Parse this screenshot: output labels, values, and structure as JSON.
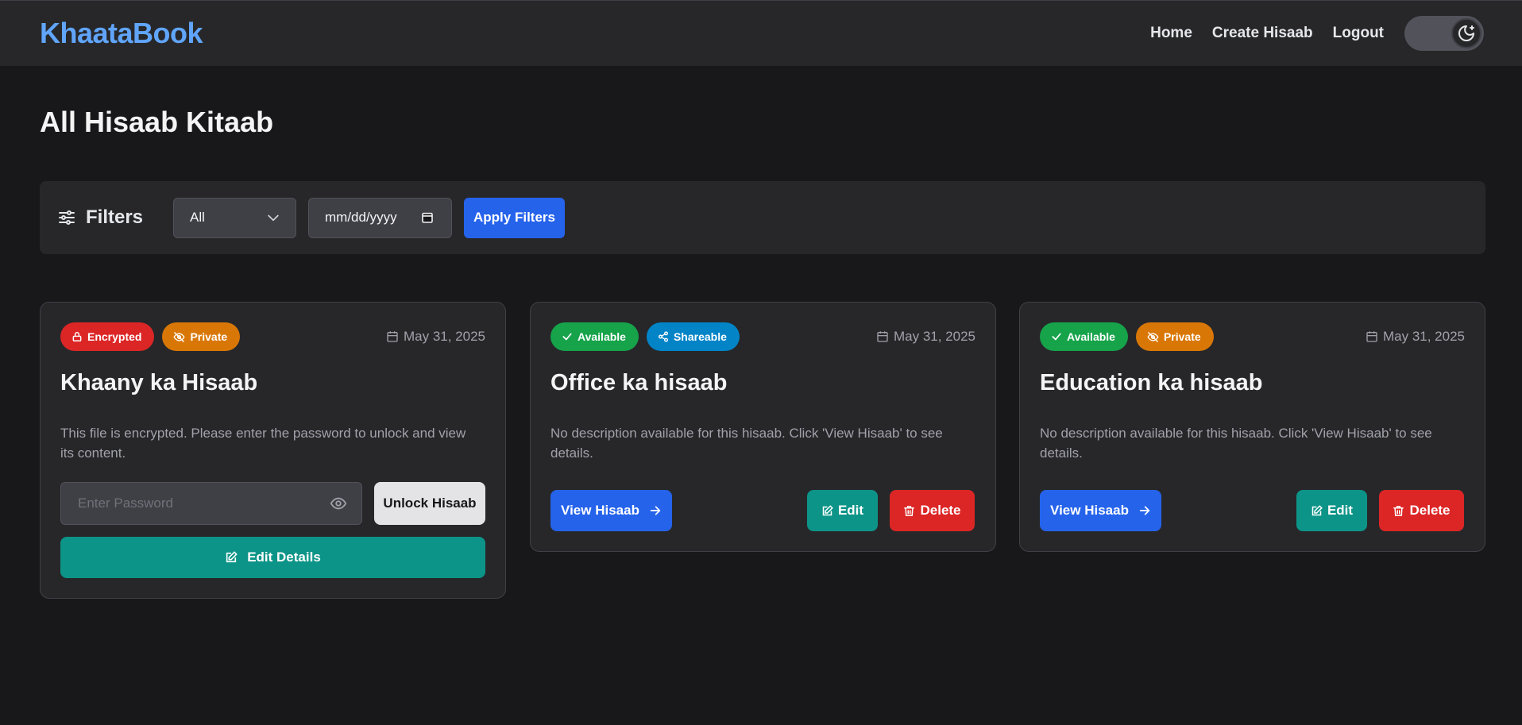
{
  "nav": {
    "brand": "KhaataBook",
    "links": [
      "Home",
      "Create Hisaab",
      "Logout"
    ],
    "theme_icon": "moon-icon"
  },
  "page": {
    "title": "All Hisaab Kitaab"
  },
  "filters": {
    "label": "Filters",
    "select_value": "All",
    "date_placeholder": "mm/dd/yyyy",
    "apply_label": "Apply Filters"
  },
  "cards": [
    {
      "badges": [
        {
          "label": "Encrypted",
          "icon": "lock-icon",
          "color": "#dc2626"
        },
        {
          "label": "Private",
          "icon": "eye-off-icon",
          "color": "#d97706"
        }
      ],
      "date": "May 31, 2025",
      "title": "Khaany ka Hisaab",
      "description": "This file is encrypted. Please enter the password to unlock and view its content.",
      "password_placeholder": "Enter Password",
      "unlock_label": "Unlock Hisaab",
      "edit_details_label": "Edit Details"
    },
    {
      "badges": [
        {
          "label": "Available",
          "icon": "check-icon",
          "color": "#16a34a"
        },
        {
          "label": "Shareable",
          "icon": "share-icon",
          "color": "#0284c7"
        }
      ],
      "date": "May 31, 2025",
      "title": "Office ka hisaab",
      "description": "No description available for this hisaab. Click 'View Hisaab' to see details.",
      "view_label": "View Hisaab",
      "edit_label": "Edit",
      "delete_label": "Delete"
    },
    {
      "badges": [
        {
          "label": "Available",
          "icon": "check-icon",
          "color": "#16a34a"
        },
        {
          "label": "Private",
          "icon": "eye-off-icon",
          "color": "#d97706"
        }
      ],
      "date": "May 31, 2025",
      "title": "Education ka hisaab",
      "description": "No description available for this hisaab. Click 'View Hisaab' to see details.",
      "view_label": "View Hisaab",
      "edit_label": "Edit",
      "delete_label": "Delete"
    }
  ],
  "colors": {
    "accent": "#2563eb",
    "brand": "#60a5fa",
    "teal": "#0d9488",
    "danger": "#dc2626",
    "background": "#18181b",
    "surface": "#27272a"
  }
}
